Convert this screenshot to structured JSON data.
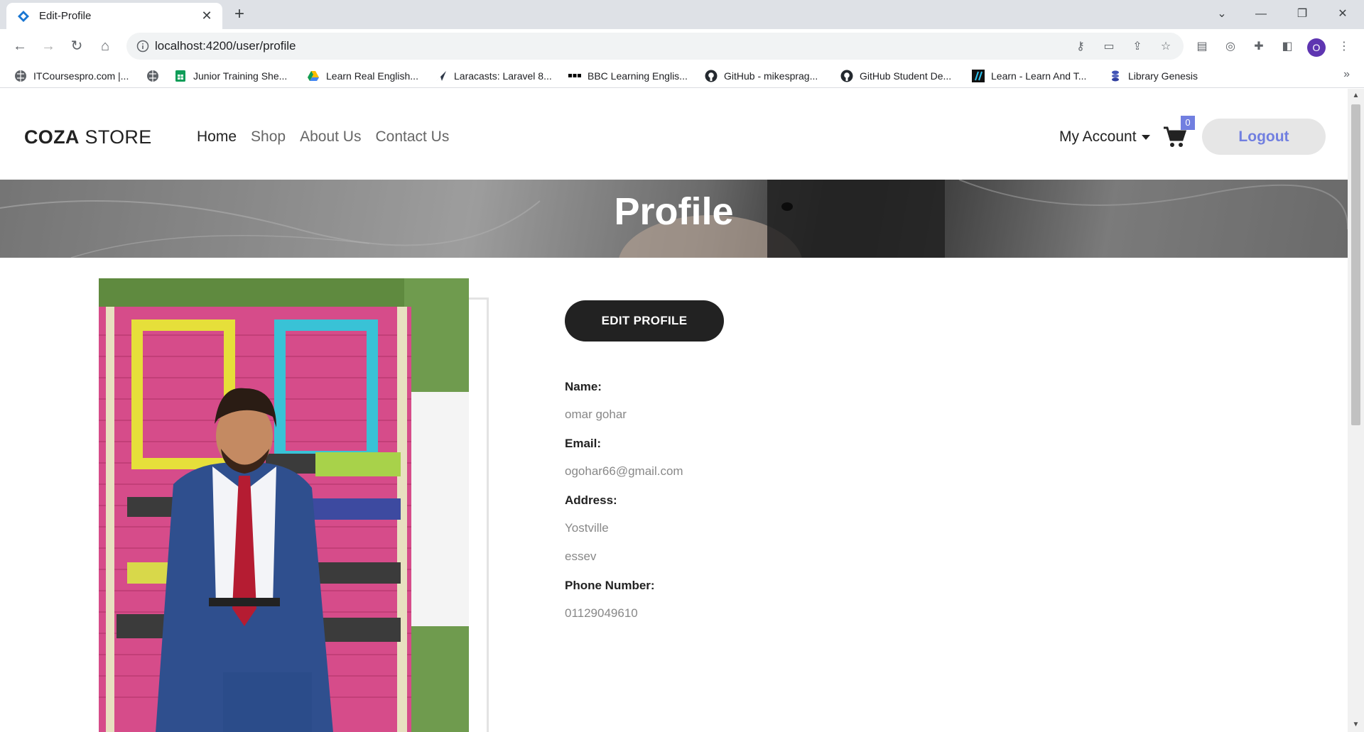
{
  "browser": {
    "tab_title": "Edit-Profile",
    "url": "localhost:4200/user/profile",
    "profile_initial": "O",
    "bookmarks": [
      {
        "label": "ITCoursespro.com |...",
        "icon": "globe-icon"
      },
      {
        "label": "",
        "icon": "globe-icon"
      },
      {
        "label": "Junior Training She...",
        "icon": "sheets-icon"
      },
      {
        "label": "Learn Real English...",
        "icon": "drive-icon"
      },
      {
        "label": "Laracasts: Laravel 8...",
        "icon": "laracasts-icon"
      },
      {
        "label": "BBC Learning Englis...",
        "icon": "bbc-icon"
      },
      {
        "label": "GitHub - mikesprag...",
        "icon": "github-icon"
      },
      {
        "label": "GitHub Student De...",
        "icon": "github-icon"
      },
      {
        "label": "Learn - Learn And T...",
        "icon": "learn-icon"
      },
      {
        "label": "Library Genesis",
        "icon": "library-icon"
      }
    ]
  },
  "site": {
    "logo_bold": "COZA",
    "logo_rest": " STORE",
    "nav": [
      "Home",
      "Shop",
      "About Us",
      "Contact Us"
    ],
    "account_label": "My Account",
    "cart_count": "0",
    "logout_label": "Logout",
    "accent": "#717fe0"
  },
  "banner": {
    "title": "Profile"
  },
  "profile": {
    "edit_button": "EDIT PROFILE",
    "name_label": "Name:",
    "name": "omar gohar",
    "email_label": "Email:",
    "email": "ogohar66@gmail.com",
    "address_label": "Address:",
    "address_line1": "Yostville",
    "address_line2": "essev",
    "phone_label": "Phone Number:",
    "phone": "01129049610"
  }
}
